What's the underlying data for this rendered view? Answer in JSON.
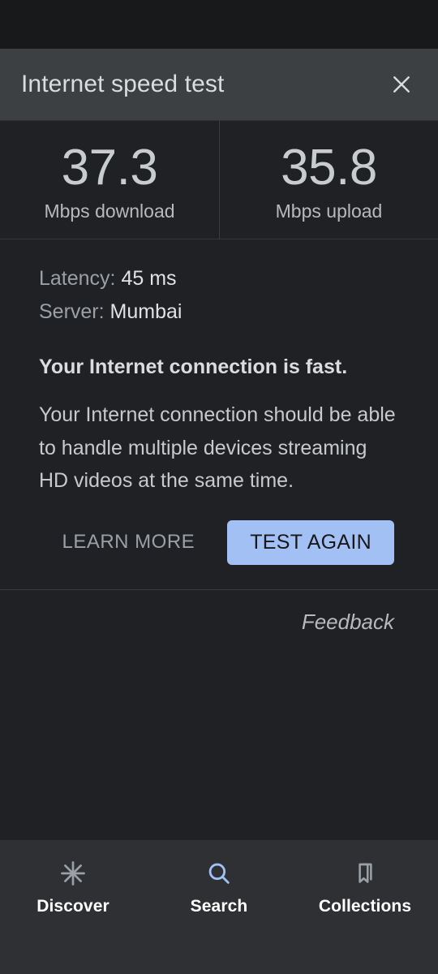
{
  "colors": {
    "accent": "#a3c0f5",
    "header_bg": "#3c4043",
    "card_bg": "#202124",
    "nav_bg": "#2e3033",
    "status_strip": "#17191a",
    "muted_text": "#9aa0a6",
    "primary_text": "#dadce0"
  },
  "dialog": {
    "title": "Internet speed test",
    "close_icon": "close-icon"
  },
  "stats": [
    {
      "value": "37.3",
      "label": "Mbps download"
    },
    {
      "value": "35.8",
      "label": "Mbps upload"
    }
  ],
  "details": {
    "latency_label": "Latency:",
    "latency_value": "45 ms",
    "server_label": "Server:",
    "server_value": "Mumbai",
    "headline": "Your Internet connection is fast.",
    "description": "Your Internet connection should be able to handle multiple devices streaming HD videos at the same time."
  },
  "actions": {
    "learn_more_label": "LEARN MORE",
    "test_again_label": "TEST AGAIN"
  },
  "feedback": {
    "label": "Feedback"
  },
  "bottom_nav": {
    "items": [
      {
        "label": "Discover",
        "icon": "sparkle-icon",
        "active": false
      },
      {
        "label": "Search",
        "icon": "search-icon",
        "active": true
      },
      {
        "label": "Collections",
        "icon": "bookmarks-icon",
        "active": false
      }
    ]
  }
}
